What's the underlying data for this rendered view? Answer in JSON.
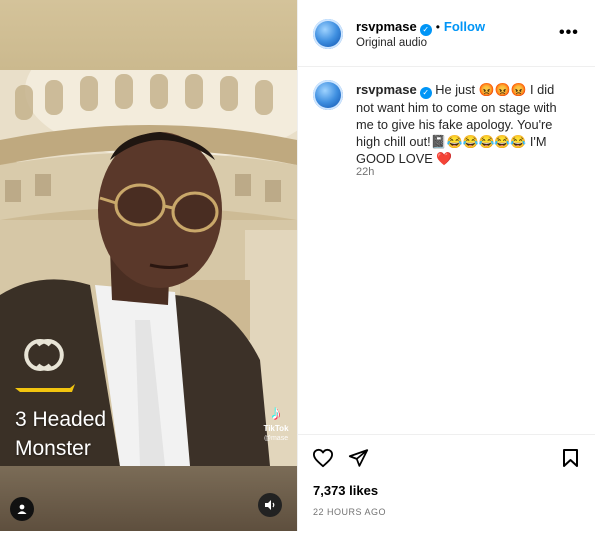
{
  "media": {
    "overlay_line1": "3 Headed",
    "overlay_line2": "Monster",
    "tiktok_label": "TikTok",
    "tiktok_handle": "@mase"
  },
  "header": {
    "username": "rsvpmase",
    "follow_label": "Follow",
    "separator": "•",
    "audio_label": "Original audio",
    "more_label": "•••"
  },
  "comment": {
    "username": "rsvpmase",
    "text": "He just 😡😡😡 I did not want him to come on stage with me to give his fake apology. You're high chill out!📓😂😂😂😂😂 I'M GOOD LOVE ❤️",
    "time": "22h"
  },
  "footer": {
    "likes": "7,373 likes",
    "posted_ago": "22 HOURS AGO"
  },
  "colors": {
    "accent": "#0095f6",
    "muted": "#737373",
    "border": "#efefef"
  },
  "icons": [
    "heart-icon",
    "share-icon",
    "bookmark-icon",
    "verified-badge-icon",
    "user-icon",
    "speaker-icon",
    "tiktok-icon",
    "more-icon"
  ]
}
